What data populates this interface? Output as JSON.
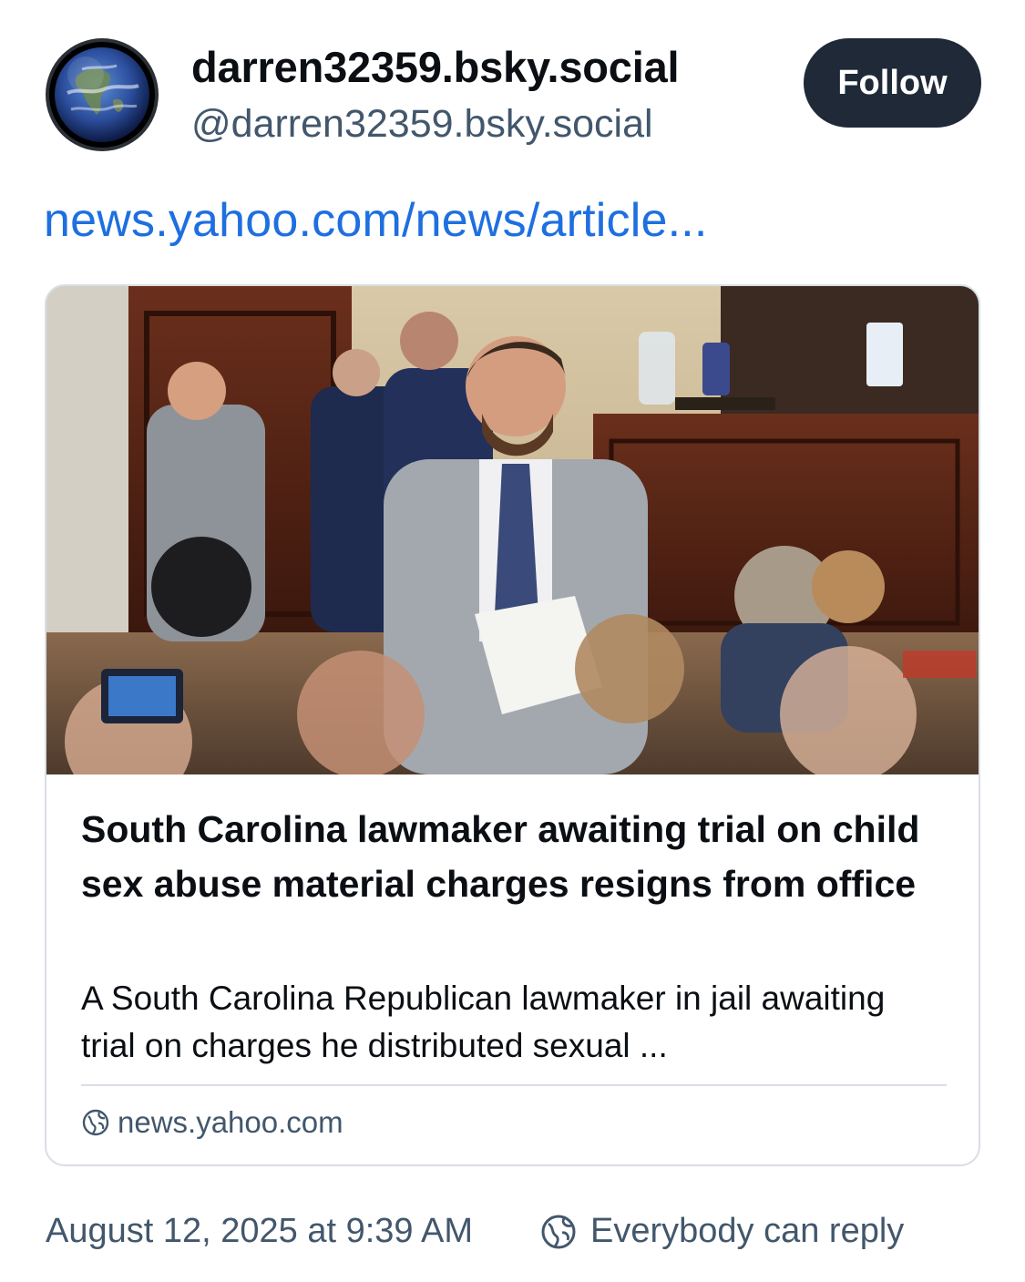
{
  "author": {
    "display_name": "darren32359.bsky.social",
    "handle": "@darren32359.bsky.social",
    "avatar_icon": "earth-globe-avatar"
  },
  "follow_button": {
    "label": "Follow"
  },
  "post": {
    "link_text": "news.yahoo.com/news/article..."
  },
  "embed": {
    "image_icon": "legislature-chamber-photo",
    "title": "South Carolina lawmaker awaiting trial on child sex abuse material charges resigns from office",
    "description": "A South Carolina Republican lawmaker in jail awaiting trial on charges he distributed sexual ...",
    "source": "news.yahoo.com",
    "source_icon": "globe-icon"
  },
  "footer": {
    "timestamp": "August 12, 2025 at 9:39 AM",
    "reply_setting": "Everybody can reply",
    "reply_icon": "globe-icon"
  },
  "colors": {
    "link": "#1e6fe0",
    "follow_bg": "#1f2937",
    "muted_text": "#42576c",
    "border": "#d9dee4"
  }
}
